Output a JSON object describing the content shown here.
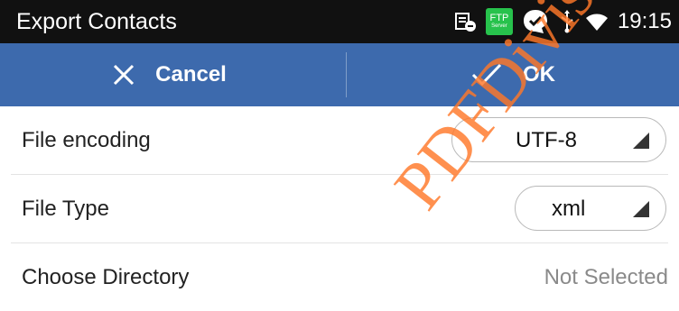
{
  "status_bar": {
    "title": "Export Contacts",
    "ftp_label": "FTP",
    "ftp_sub": "Server",
    "time": "19:15",
    "icons": [
      "contacts-sync-icon",
      "ftp-server-icon",
      "chat-icon",
      "usb-icon",
      "wifi-icon"
    ]
  },
  "action_bar": {
    "cancel_label": "Cancel",
    "ok_label": "OK",
    "background": "#3d6aad"
  },
  "form": {
    "rows": [
      {
        "label": "File encoding",
        "value": "UTF-8"
      },
      {
        "label": "File Type",
        "value": "xml"
      },
      {
        "label": "Choose Directory",
        "value": "Not Selected"
      }
    ]
  },
  "watermark": {
    "text": "PDFDivision",
    "color": "#ff7828"
  }
}
